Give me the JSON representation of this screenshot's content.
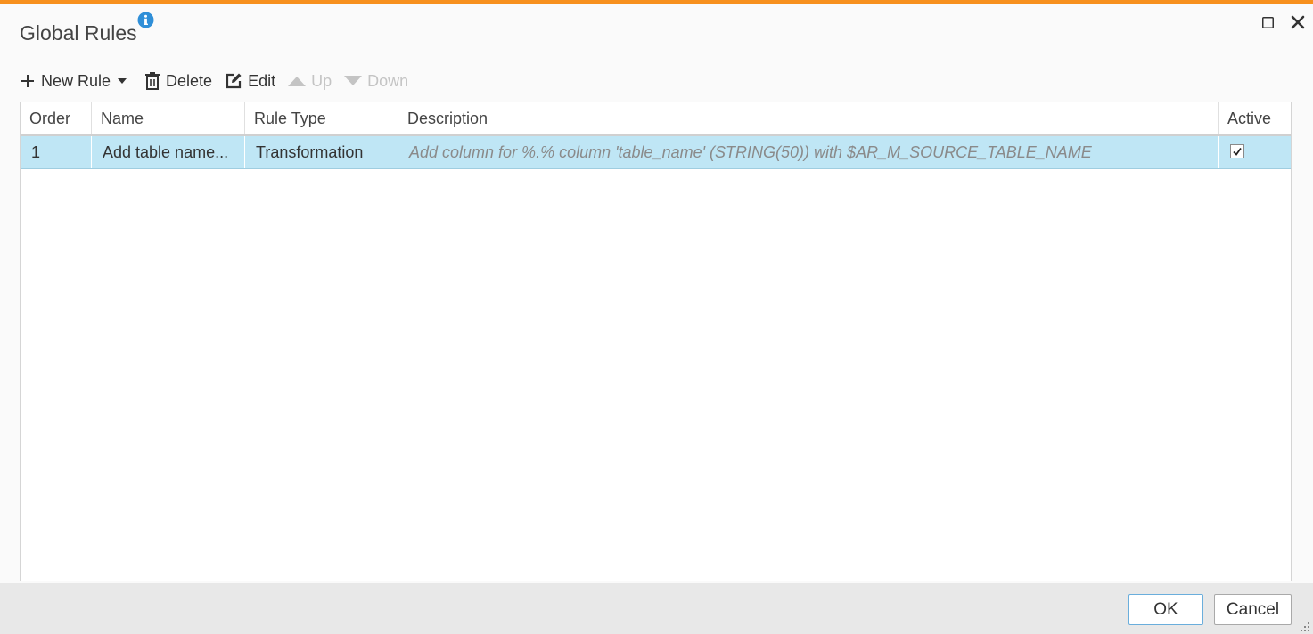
{
  "colors": {
    "accent_bar": "#f7901e",
    "info_icon": "#2f8fd8",
    "selected_row": "#bfe6f5"
  },
  "dialog": {
    "title": "Global Rules"
  },
  "icons": {
    "info": "info-icon",
    "maximize": "maximize-icon",
    "close": "close-icon",
    "new_rule": "plus-icon",
    "new_rule_menu": "caret-down-icon",
    "delete": "trash-icon",
    "edit": "edit-icon",
    "up": "triangle-up-icon",
    "down": "triangle-down-icon",
    "active_check": "checkmark-icon",
    "resize": "resize-grip-icon"
  },
  "toolbar": {
    "new_rule": "New Rule",
    "delete": "Delete",
    "edit": "Edit",
    "up": "Up",
    "down": "Down"
  },
  "table": {
    "columns": [
      "Order",
      "Name",
      "Rule Type",
      "Description",
      "Active"
    ],
    "rows": [
      {
        "order": "1",
        "name": "Add table name...",
        "rule_type": "Transformation",
        "description": "Add column for %.% column 'table_name' (STRING(50)) with $AR_M_SOURCE_TABLE_NAME",
        "active": true
      }
    ]
  },
  "footer": {
    "ok": "OK",
    "cancel": "Cancel"
  }
}
